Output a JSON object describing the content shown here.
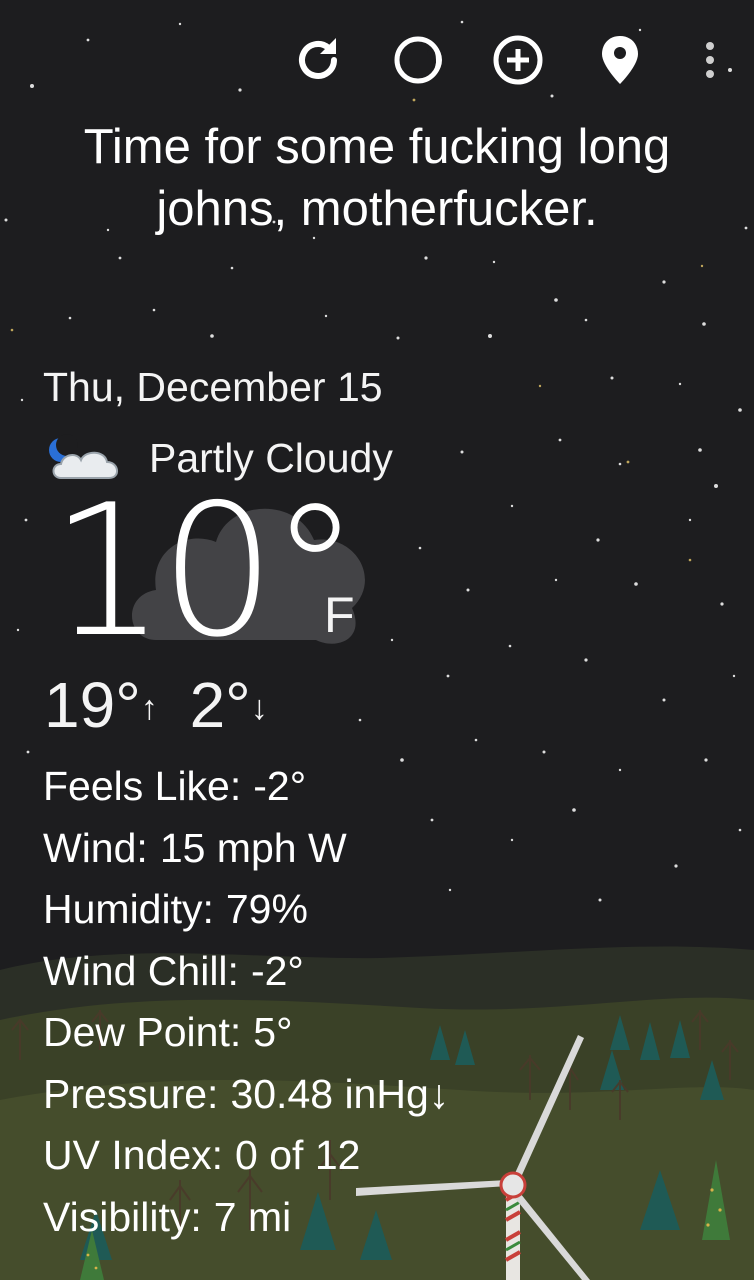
{
  "toolbar": {
    "items": [
      {
        "icon": "refresh-icon"
      },
      {
        "icon": "moon-phase-icon"
      },
      {
        "icon": "add-location-icon"
      },
      {
        "icon": "location-pin-icon"
      },
      {
        "icon": "more-vert-icon"
      }
    ]
  },
  "quote": "Time for some fucking long johns, motherfucker.",
  "date": "Thu, December 15",
  "condition": {
    "icon": "partly-cloudy-night-icon",
    "text": "Partly Cloudy"
  },
  "temperature": {
    "current": "10°",
    "unit": "F",
    "high": "19°",
    "high_arrow": "↑",
    "low": "2°",
    "low_arrow": "↓"
  },
  "details": [
    {
      "label": "Feels Like:",
      "value": "-2°"
    },
    {
      "label": "Wind:",
      "value": "15 mph W"
    },
    {
      "label": "Humidity:",
      "value": "79%"
    },
    {
      "label": "Wind Chill:",
      "value": "-2°"
    },
    {
      "label": "Dew Point:",
      "value": "5°"
    },
    {
      "label": "Pressure:",
      "value": "30.48 inHg↓"
    },
    {
      "label": "UV Index:",
      "value": "0 of 12"
    },
    {
      "label": "Visibility:",
      "value": "7 mi"
    }
  ],
  "colors": {
    "sky": "#1d1d1f",
    "hills": "#3b4226",
    "trees": "#1f5a55",
    "moon": "#2a6fd6"
  }
}
